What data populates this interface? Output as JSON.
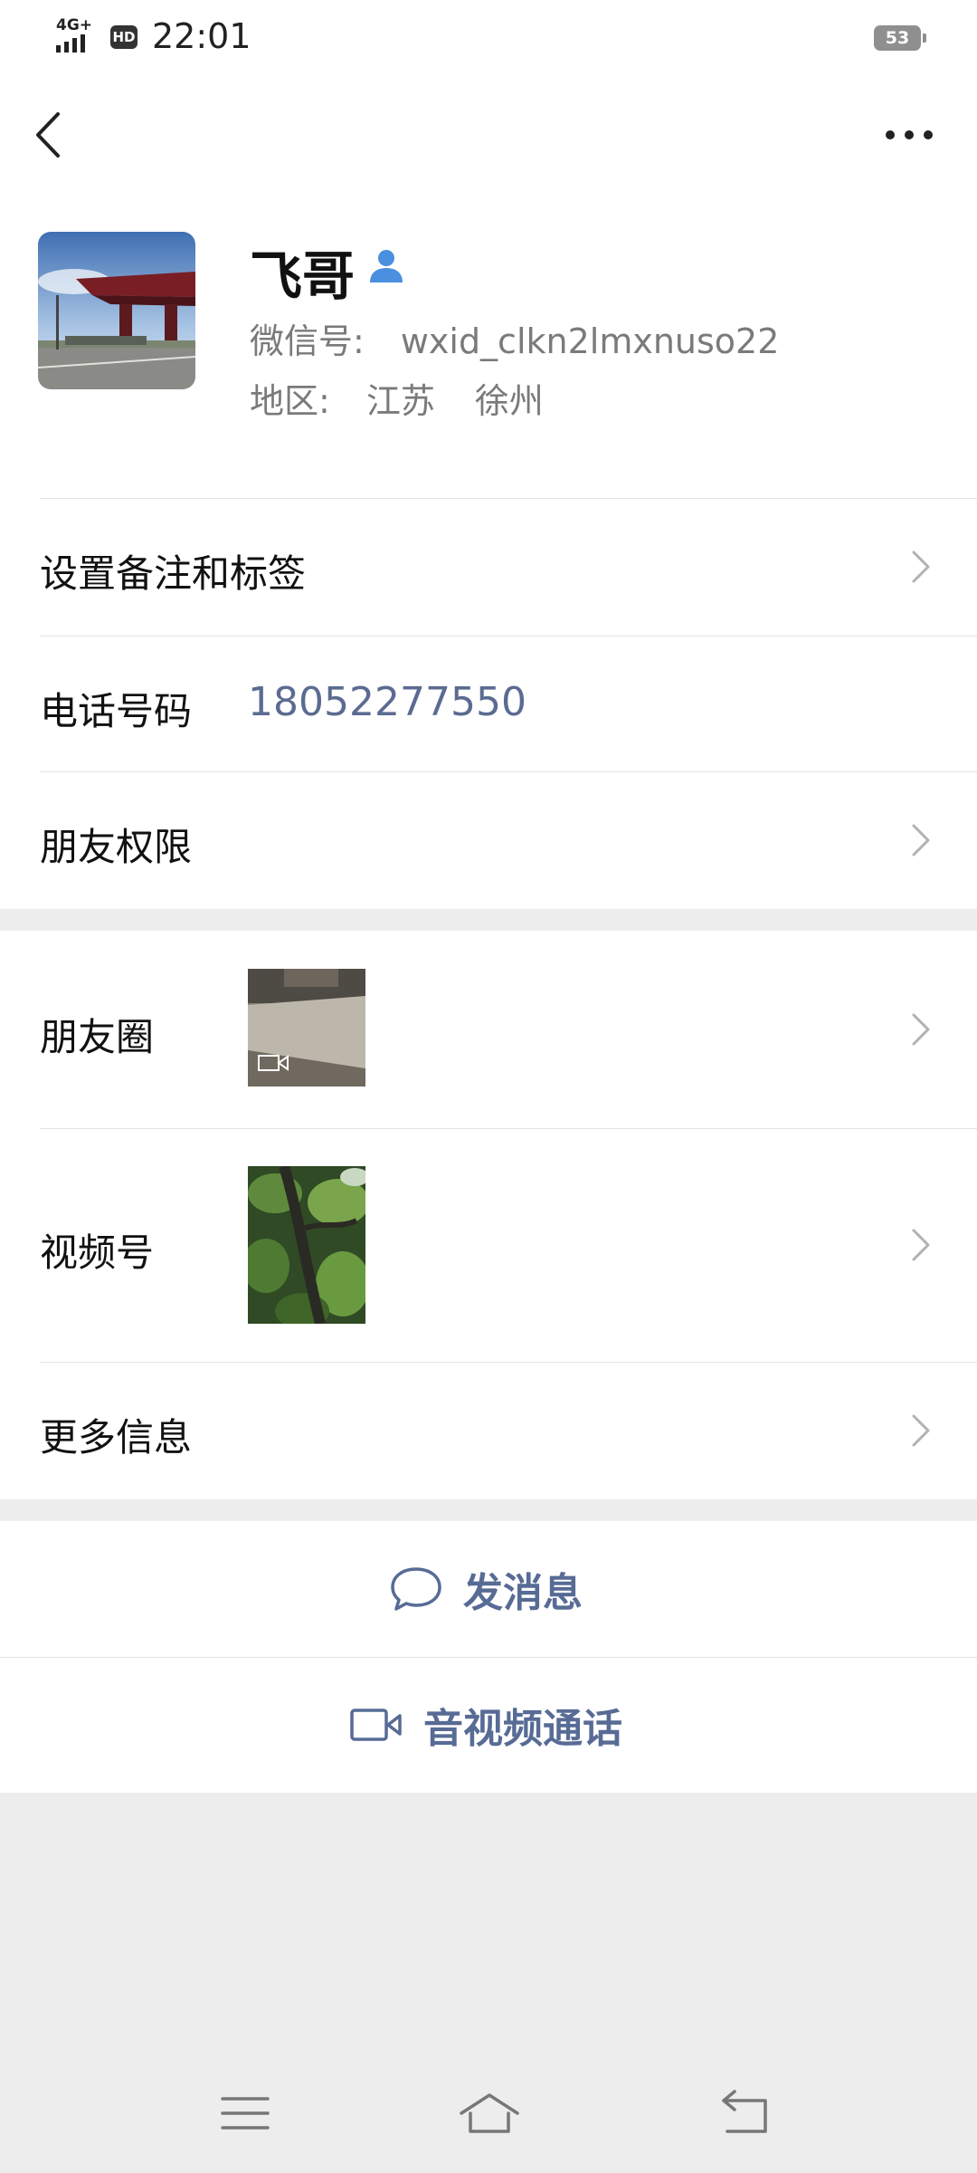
{
  "status_bar": {
    "network": "4G+",
    "hd": "HD",
    "time": "22:01",
    "battery": "53"
  },
  "profile": {
    "name": "飞哥",
    "wxid_label": "微信号:",
    "wxid": "wxid_clkn2lmxnuso22",
    "region_label": "地区:",
    "province": "江苏",
    "city": "徐州"
  },
  "rows": {
    "remark": "设置备注和标签",
    "phone_label": "电话号码",
    "phone_value": "18052277550",
    "permissions": "朋友权限",
    "moments": "朋友圈",
    "channels": "视频号",
    "more_info": "更多信息"
  },
  "actions": {
    "message": "发消息",
    "call": "音视频通话"
  },
  "colors": {
    "accent": "#576b95",
    "phone": "#5b6b91",
    "verified": "#4a8fe0",
    "background": "#ededed"
  }
}
